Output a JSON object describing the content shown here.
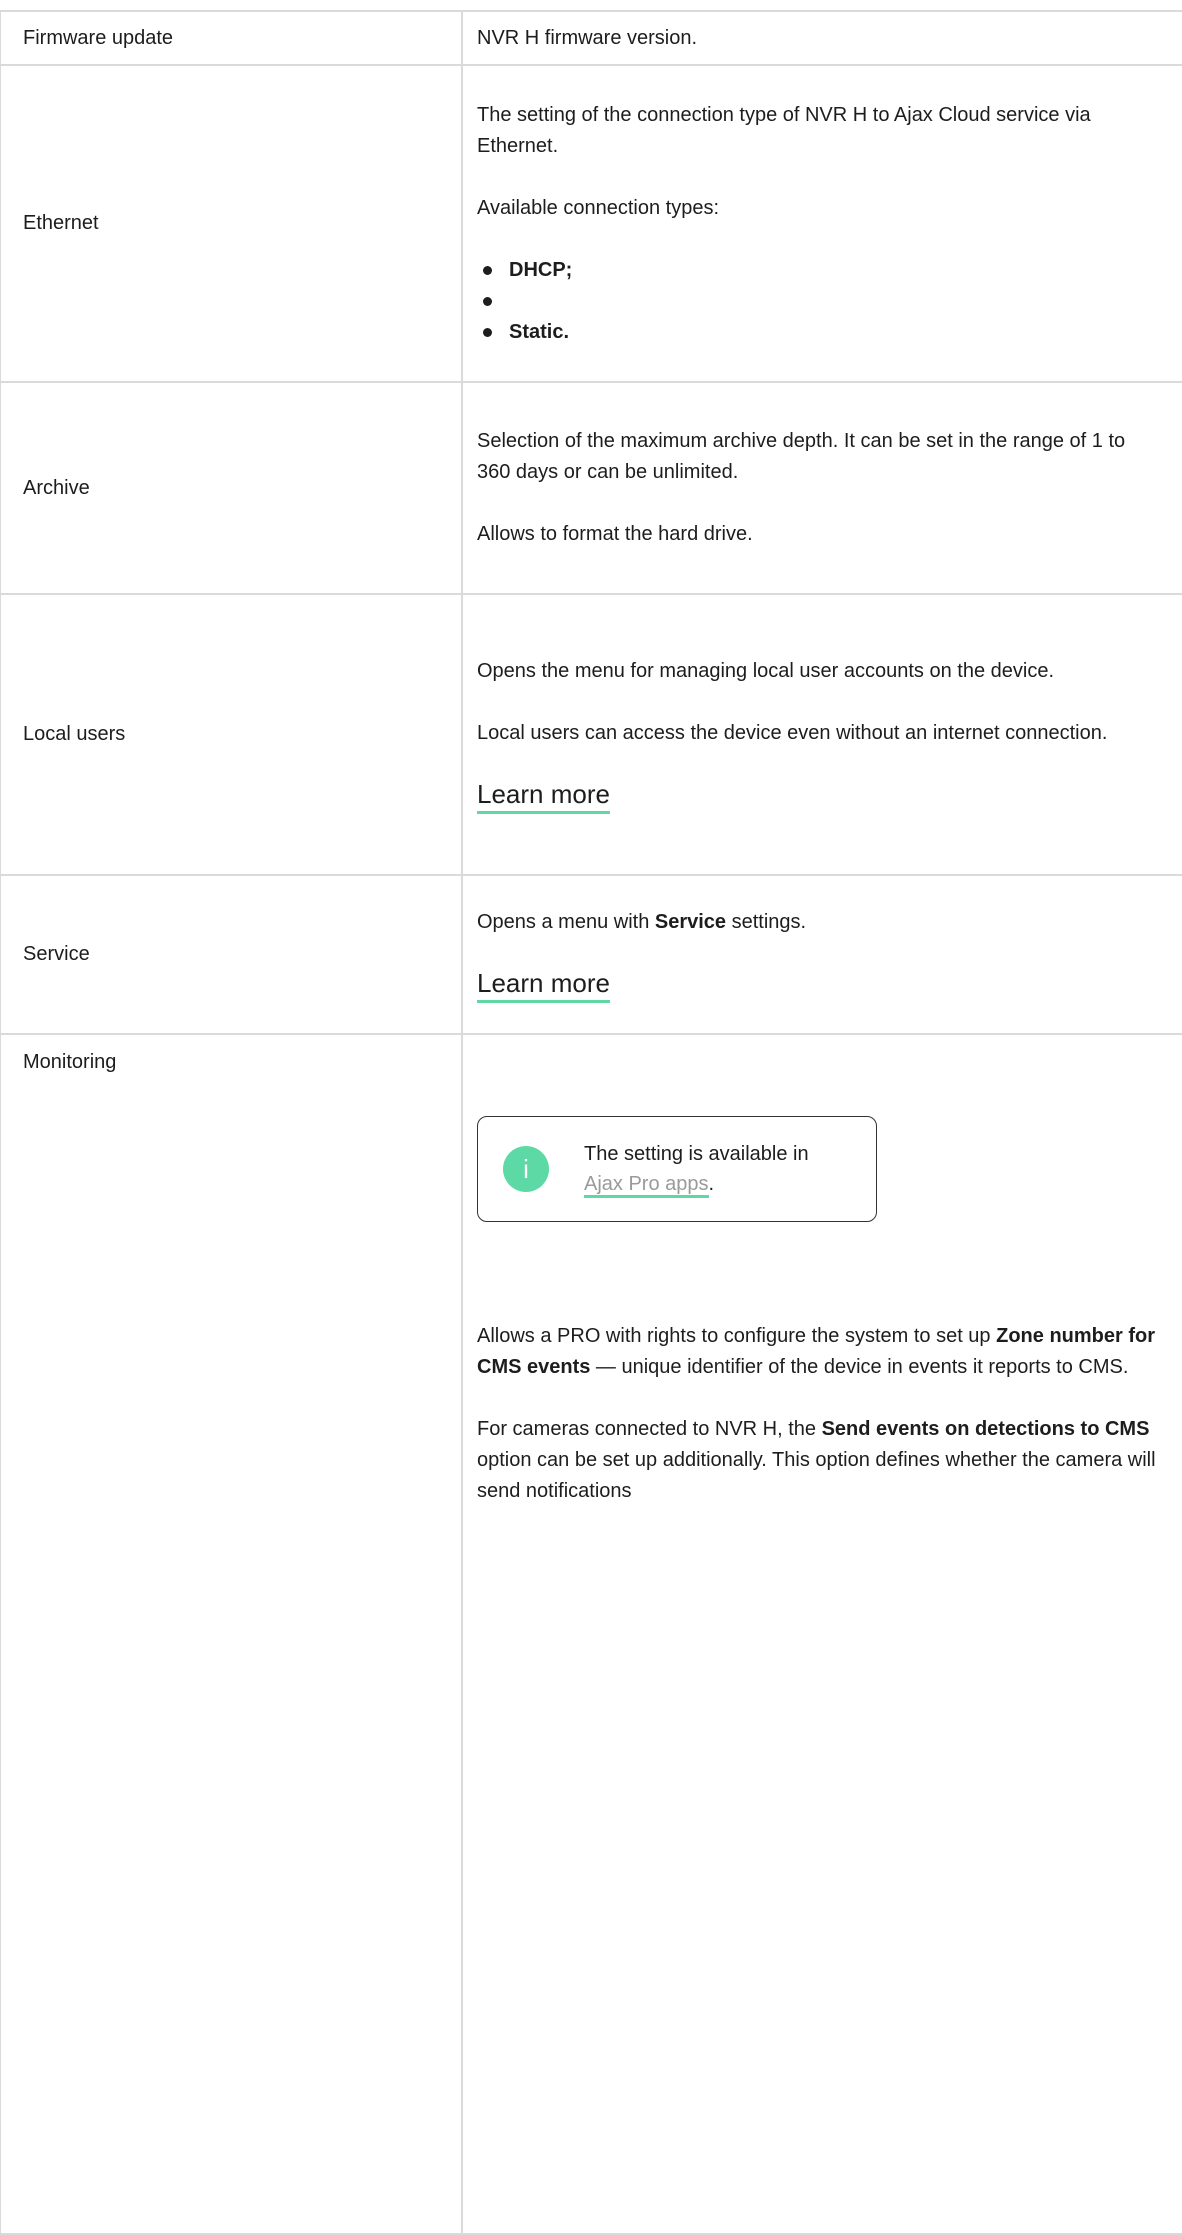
{
  "rows": [
    {
      "name": "Firmware update",
      "desc": [
        "NVR H firmware version."
      ]
    },
    {
      "name": "Ethernet",
      "desc": [
        "The setting of the connection type of NVR H to Ajax Cloud service via Ethernet.",
        "Available connection types:"
      ],
      "bullets": [
        "DHCP;",
        "Static."
      ]
    },
    {
      "name": "Archive",
      "desc": [
        "Selection of the maximum archive depth. It can be set in the range of 1 to 360 days or can be unlimited.",
        "Allows to format the hard drive."
      ]
    },
    {
      "name": "Local users",
      "desc": [
        "Opens the menu for managing local user accounts on the device.",
        "Local users can access the device even without an internet connection."
      ],
      "link": "Learn more"
    },
    {
      "name": "Service",
      "desc_pre": "Opens a menu with ",
      "desc_bold": "Service",
      "desc_post": " settings.",
      "link": "Learn more"
    },
    {
      "name": "Monitoring",
      "note": {
        "pre": "The setting is available in ",
        "link": "Ajax Pro apps",
        "post": ".",
        "icon": "info-icon"
      },
      "p1": {
        "a": "Allows a PRO with rights to configure the system to set up ",
        "b": "Zone number for CMS events",
        "c": " — unique identifier of the device in events it reports to CMS."
      },
      "p2": {
        "a": "For cameras connected to NVR H, the ",
        "b": "Send events on detections to CMS",
        "c": " option can be set up additionally. This option defines whether the camera will send notifications"
      }
    }
  ]
}
